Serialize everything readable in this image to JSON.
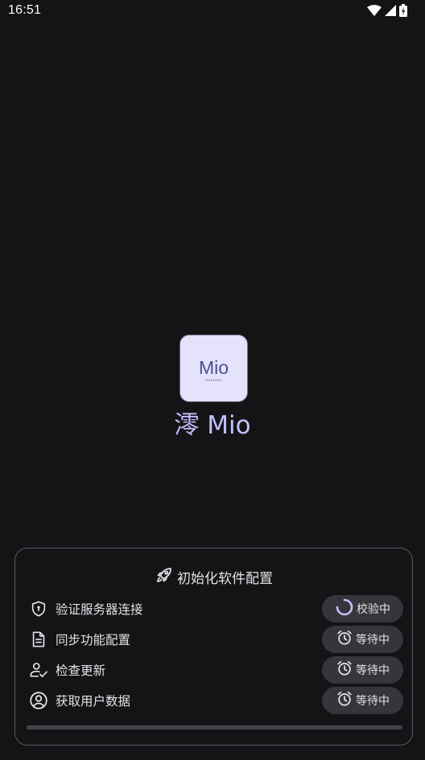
{
  "status_bar": {
    "time": "16:51"
  },
  "app": {
    "logo_text": "Mio",
    "logo_subtext": "SHUIMIO",
    "title": "澪 Mio"
  },
  "init_card": {
    "title": "初始化软件配置",
    "tasks": [
      {
        "label": "验证服务器连接",
        "icon": "shield-icon",
        "status": "校验中",
        "status_icon": "spinner-icon"
      },
      {
        "label": "同步功能配置",
        "icon": "document-icon",
        "status": "等待中",
        "status_icon": "alarm-clock-icon"
      },
      {
        "label": "检查更新",
        "icon": "person-check-icon",
        "status": "等待中",
        "status_icon": "alarm-clock-icon"
      },
      {
        "label": "获取用户数据",
        "icon": "account-circle-icon",
        "status": "等待中",
        "status_icon": "alarm-clock-icon"
      }
    ],
    "progress": 0
  },
  "colors": {
    "background": "#141316",
    "accent": "#c3c0ff",
    "chip_bg": "#36353b",
    "logo_bg": "#e5e3fb"
  }
}
